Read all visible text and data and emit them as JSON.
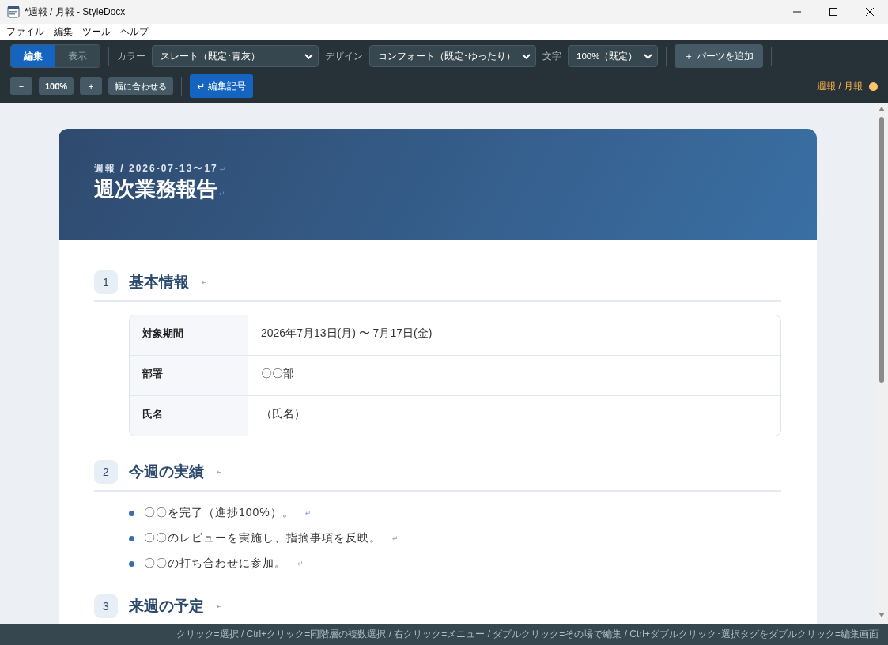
{
  "window": {
    "title": "*週報 / 月報 - StyleDocx"
  },
  "menu": [
    "ファイル",
    "編集",
    "ツール",
    "ヘルプ"
  ],
  "toolbar": {
    "modes": [
      {
        "label": "編集",
        "selected": true
      },
      {
        "label": "表示",
        "selected": false
      }
    ],
    "selects": [
      {
        "label": "カラー",
        "value": "スレート（既定･青灰）"
      },
      {
        "label": "デザイン",
        "value": "コンフォート（既定･ゆったり）"
      },
      {
        "label": "文字",
        "value": "100%（既定）"
      }
    ],
    "add_button": "＋ パーツを追加",
    "zoom": {
      "minus": "−",
      "value": "100%",
      "plus": "+",
      "fit": "幅に合わせる"
    },
    "marks_button": {
      "icon": "↵",
      "label": "編集記号",
      "on": true
    },
    "doc_status": {
      "label": "週報 / 月報",
      "color": "#ffc36b"
    }
  },
  "document": {
    "kicker": "週報 / 2026-07-13〜17",
    "title": "週次業務報告",
    "end_mark": "↵",
    "sections": [
      {
        "number": "1",
        "heading": "基本情報",
        "kind": "table",
        "rows": [
          {
            "label": "対象期間",
            "value": "2026年7月13日(月) 〜 7月17日(金)"
          },
          {
            "label": "部署",
            "value": "〇〇部"
          },
          {
            "label": "氏名",
            "value": "（氏名）"
          }
        ]
      },
      {
        "number": "2",
        "heading": "今週の実績",
        "kind": "list",
        "items": [
          "〇〇を完了（進捗100%）。",
          "〇〇のレビューを実施し、指摘事項を反映。",
          "〇〇の打ち合わせに参加。"
        ]
      },
      {
        "number": "3",
        "heading": "来週の予定",
        "kind": "list"
      }
    ]
  },
  "status_bar": "クリック=選択 / Ctrl+クリック=同階層の複数選択 / 右クリック=メニュー / ダブルクリック=その場で編集 / Ctrl+ダブルクリック･選択タグをダブルクリック=編集画面"
}
